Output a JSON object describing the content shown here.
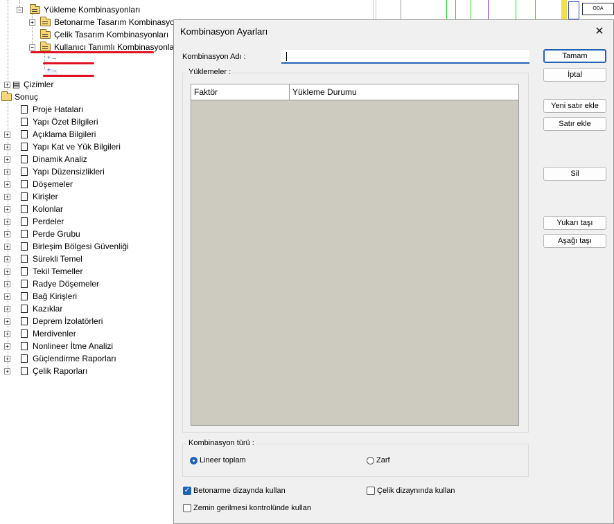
{
  "tree": {
    "items": [
      {
        "label": "Yükleme Kombinasyonları",
        "icon": "folder-open-icon",
        "expander": "−"
      },
      {
        "label": "Betonarme Tasarım Kombinasyonları",
        "icon": "folder-icon",
        "expander": "+"
      },
      {
        "label": "Çelik Tasarım Kombinasyonları",
        "icon": "folder-icon",
        "expander": ""
      },
      {
        "label": "Kullanıcı Tanımlı Kombinasyonlar",
        "icon": "folder-icon",
        "expander": "−"
      },
      {
        "label": "",
        "icon": "combination-icon",
        "expander": ""
      },
      {
        "label": "",
        "icon": "combination-icon",
        "expander": ""
      },
      {
        "label": "Çizimler",
        "icon": "drawings-icon",
        "expander": "+"
      },
      {
        "label": "Sonuç",
        "icon": "folder-icon",
        "expander": ""
      },
      {
        "label": "Proje Hataları",
        "icon": "document-icon",
        "expander": ""
      },
      {
        "label": "Yapı Özet Bilgileri",
        "icon": "document-icon",
        "expander": ""
      },
      {
        "label": "Açıklama Bilgileri",
        "icon": "document-icon",
        "expander": "+"
      },
      {
        "label": "Yapı Kat ve Yük Bilgileri",
        "icon": "document-icon",
        "expander": "+"
      },
      {
        "label": "Dinamik Analiz",
        "icon": "document-icon",
        "expander": "+"
      },
      {
        "label": "Yapı Düzensizlikleri",
        "icon": "document-icon",
        "expander": "+"
      },
      {
        "label": "Döşemeler",
        "icon": "document-icon",
        "expander": "+"
      },
      {
        "label": "Kirişler",
        "icon": "document-icon",
        "expander": "+"
      },
      {
        "label": "Kolonlar",
        "icon": "document-icon",
        "expander": "+"
      },
      {
        "label": "Perdeler",
        "icon": "document-icon",
        "expander": "+"
      },
      {
        "label": "Perde Grubu",
        "icon": "document-icon",
        "expander": "+"
      },
      {
        "label": "Birleşim Bölgesi Güvenliği",
        "icon": "document-icon",
        "expander": "+"
      },
      {
        "label": "Sürekli Temel",
        "icon": "document-icon",
        "expander": "+"
      },
      {
        "label": "Tekil Temeller",
        "icon": "document-icon",
        "expander": "+"
      },
      {
        "label": "Radye Döşemeler",
        "icon": "document-icon",
        "expander": "+"
      },
      {
        "label": "Bağ Kirişleri",
        "icon": "document-icon",
        "expander": "+"
      },
      {
        "label": "Kazıklar",
        "icon": "document-icon",
        "expander": "+"
      },
      {
        "label": "Deprem İzolatörleri",
        "icon": "document-icon",
        "expander": "+"
      },
      {
        "label": "Merdivenler",
        "icon": "document-icon",
        "expander": "+"
      },
      {
        "label": "Nonlineer İtme Analizi",
        "icon": "document-icon",
        "expander": "+"
      },
      {
        "label": "Güçlendirme Raporları",
        "icon": "document-icon",
        "expander": "+"
      },
      {
        "label": "Çelik Raporları",
        "icon": "document-icon",
        "expander": "+"
      }
    ]
  },
  "dialog": {
    "title": "Kombinasyon Ayarları",
    "close_glyph": "✕",
    "name_label": "Kombinasyon Adı :",
    "name_value": "",
    "loads_group": "Yüklemeler :",
    "columns": [
      "Faktör",
      "Yükleme Durumu"
    ],
    "rows": [],
    "buttons": {
      "ok": "Tamam",
      "cancel": "İptal",
      "new_row": "Yeni satır ekle",
      "add_row": "Satır ekle",
      "delete": "Sil",
      "move_up": "Yukarı taşı",
      "move_down": "Aşağı taşı"
    },
    "type_group": "Kombinasyon türü :",
    "type_options": [
      {
        "label": "Lineer toplam",
        "selected": true
      },
      {
        "label": "Zarf",
        "selected": false
      }
    ],
    "checkboxes": [
      {
        "label": "Betonarme dizaynda kullan",
        "checked": true
      },
      {
        "label": "Çelik dizaynında kullan",
        "checked": false
      },
      {
        "label": "Zemin gerilmesi kontrolünde kullan",
        "checked": false
      }
    ]
  },
  "background": {
    "corner_label": "ODA"
  },
  "colors": {
    "accent": "#1f64b4",
    "grid_background": "#cdcac0",
    "highlight_underline": "#e0101e"
  }
}
